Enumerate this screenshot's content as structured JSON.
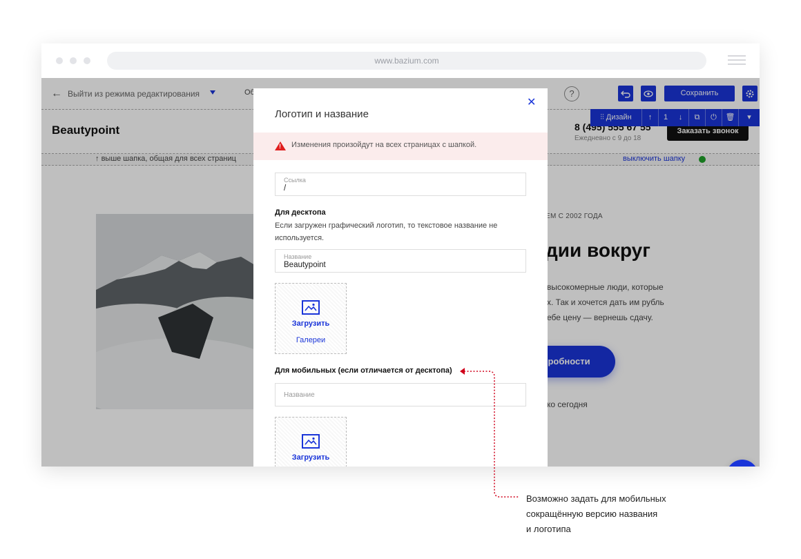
{
  "browser": {
    "url": "www.bazium.com"
  },
  "editbar": {
    "exit_label": "Выйти из режима редактирования",
    "obsh_label": "Об",
    "help_label": "?",
    "save_label": "Сохранить"
  },
  "header": {
    "brand": "Beautypoint",
    "phone": "8 (495) 555 67 55",
    "hours": "Ежедневно с 9 до 18",
    "call_button": "Заказать звонок"
  },
  "toolbar": {
    "design_label": "Дизайн",
    "number": "1"
  },
  "hint": {
    "left": "выше шапка, общая для всех страниц",
    "right": "выключить шапку"
  },
  "hero": {
    "since": "ЕМ С 2002 ГОДА",
    "headline": "дии вокруг",
    "para_lines": [
      "высокомерные люди, которые",
      "х. Так и хочется дать им рубль",
      "ебе цену — вернешь сдачу."
    ],
    "more_label": "робности",
    "today": "ко сегодня"
  },
  "modal": {
    "title": "Логотип и название",
    "warning": "Изменения произойдут на всех страницах с шапкой.",
    "link_label": "Ссылка",
    "link_value": "/",
    "desktop_title": "Для десктопа",
    "desktop_desc": "Если загружен графический логотип, то текстовое название не используется.",
    "name_label": "Название",
    "name_value": "Beautypoint",
    "upload_label": "Загрузить",
    "gallery_label": "Галереи",
    "mobile_title": "Для мобильных (если отличается от десктопа)",
    "mobile_name_placeholder": "Название",
    "mobile_upload_label": "Загрузить"
  },
  "annotation": {
    "lines": [
      "Возможно задать для мобильных",
      "сокращённую версию названия",
      "и логотипа"
    ]
  },
  "colors": {
    "accent": "#1a35d9",
    "warning_bg": "#fbecec",
    "warning_icon": "#e01f1f",
    "annotation_line": "#d0021b"
  }
}
